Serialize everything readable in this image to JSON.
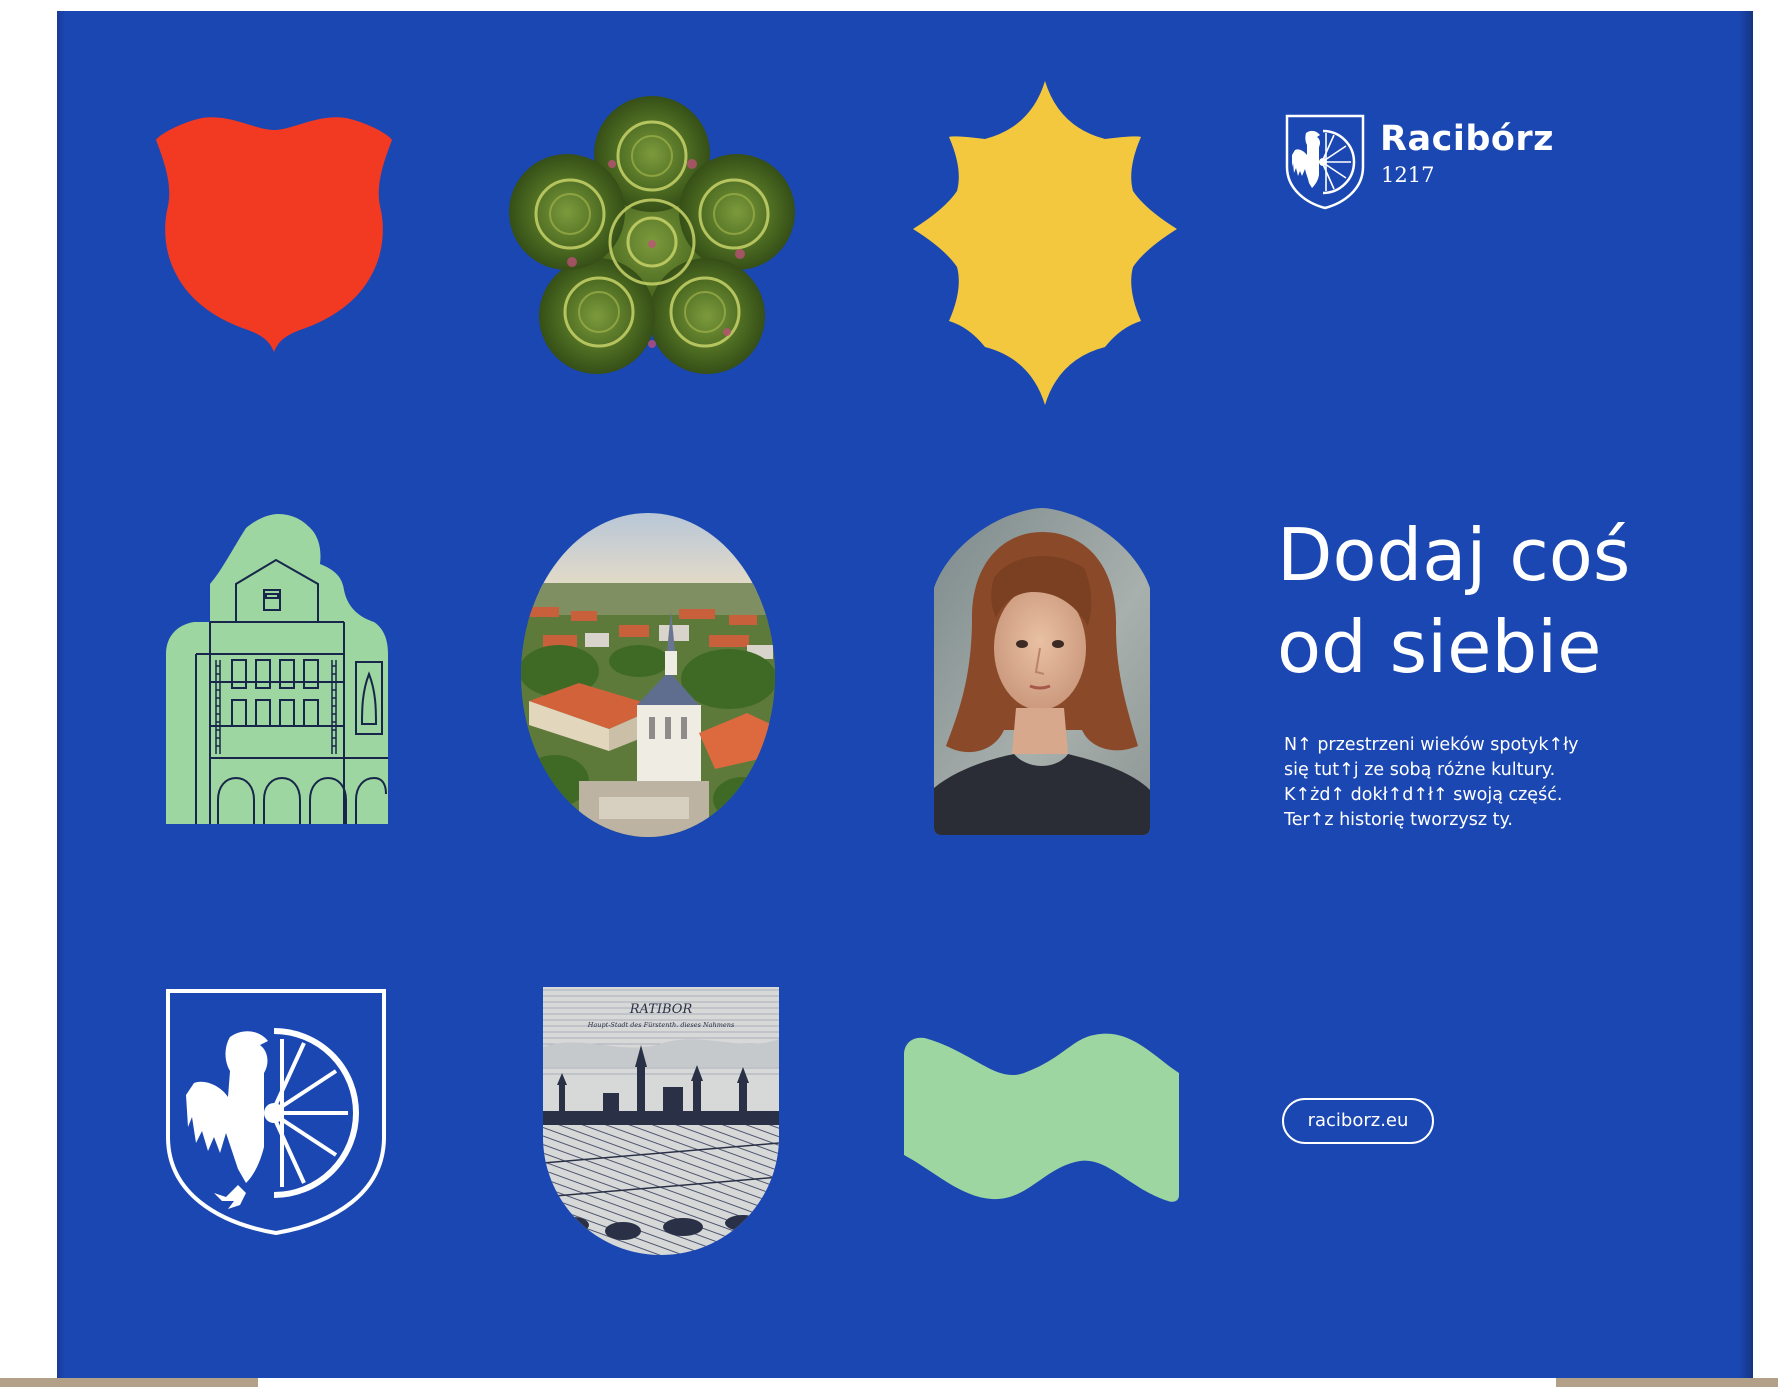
{
  "brand": {
    "name": "Racibórz",
    "year": "1217",
    "emblem_icon": "eagle-wheel-crest-icon"
  },
  "headline": {
    "line1": "Dodaj coś",
    "line2": "od siebie"
  },
  "body": {
    "line1": "N↑ przestrzeni wieków spotyk↑ły",
    "line2": "się tut↑j ze sobą różne kultury.",
    "line3": "K↑żd↑ dokł↑d↑ł↑ swoją część.",
    "line4": "Ter↑z historię tworzysz ty."
  },
  "link": {
    "label": "raciborz.eu"
  },
  "tiles": [
    {
      "name": "red-shield-shape",
      "icon": "shield-icon"
    },
    {
      "name": "garden-rosette-photo",
      "icon": "flower-garden-icon"
    },
    {
      "name": "yellow-star-shape",
      "icon": "star-burst-icon"
    },
    {
      "name": "green-townhouse-illustration",
      "icon": "townhouse-icon"
    },
    {
      "name": "city-aerial-photo",
      "icon": "city-photo-icon"
    },
    {
      "name": "portrait-photo",
      "icon": "portrait-icon"
    },
    {
      "name": "coat-of-arms",
      "icon": "eagle-wheel-crest-icon"
    },
    {
      "name": "historic-engraving",
      "icon": "engraving-icon"
    },
    {
      "name": "green-wave-shape",
      "icon": "wave-icon"
    }
  ],
  "engraving": {
    "caption_title": "RATIBOR",
    "caption_sub": "Haupt-Stadt des Fürstenth. dieses Nahmens"
  },
  "colors": {
    "panel_blue": "#1b47b2",
    "red": "#f23a22",
    "yellow": "#f3c83e",
    "mint": "#9dd6a0",
    "white": "#ffffff",
    "ground": "#b3a089"
  }
}
